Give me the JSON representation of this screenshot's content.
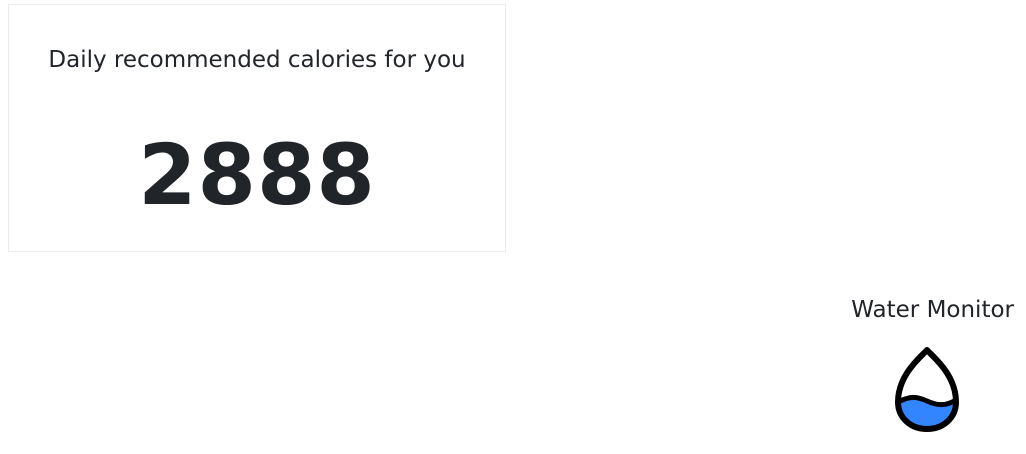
{
  "calories": {
    "title": "Daily recommended calories for you",
    "value": "2888"
  },
  "water_monitor": {
    "title": "Water Monitor",
    "icon": "water-drop-icon",
    "fill_color": "#3385ff",
    "outline_color": "#000000"
  }
}
